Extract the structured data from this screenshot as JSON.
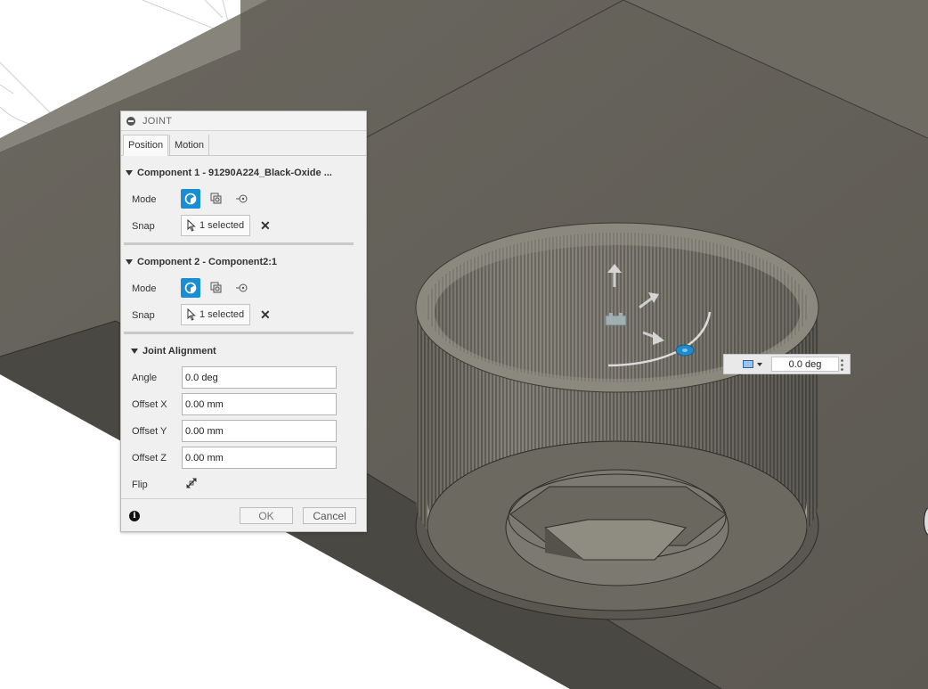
{
  "dialog": {
    "title": "JOINT",
    "tabs": [
      {
        "label": "Position"
      },
      {
        "label": "Motion"
      }
    ],
    "component1": {
      "header": "Component 1 - 91290A224_Black-Oxide ...",
      "mode_label": "Mode",
      "snap_label": "Snap",
      "snap_value": "1 selected"
    },
    "component2": {
      "header": "Component 2 - Component2:1",
      "mode_label": "Mode",
      "snap_label": "Snap",
      "snap_value": "1 selected"
    },
    "alignment": {
      "header": "Joint Alignment",
      "angle_label": "Angle",
      "angle_value": "0.0 deg",
      "offset_x_label": "Offset X",
      "offset_x_value": "0.00 mm",
      "offset_y_label": "Offset Y",
      "offset_y_value": "0.00 mm",
      "offset_z_label": "Offset Z",
      "offset_z_value": "0.00 mm",
      "flip_label": "Flip"
    },
    "ok_label": "OK",
    "cancel_label": "Cancel"
  },
  "viewport_manipulator": {
    "angle_value": "0.0 deg"
  },
  "colors": {
    "accent": "#1a8ed4",
    "model_face": "#5f5c55",
    "model_light": "#8a867d"
  }
}
